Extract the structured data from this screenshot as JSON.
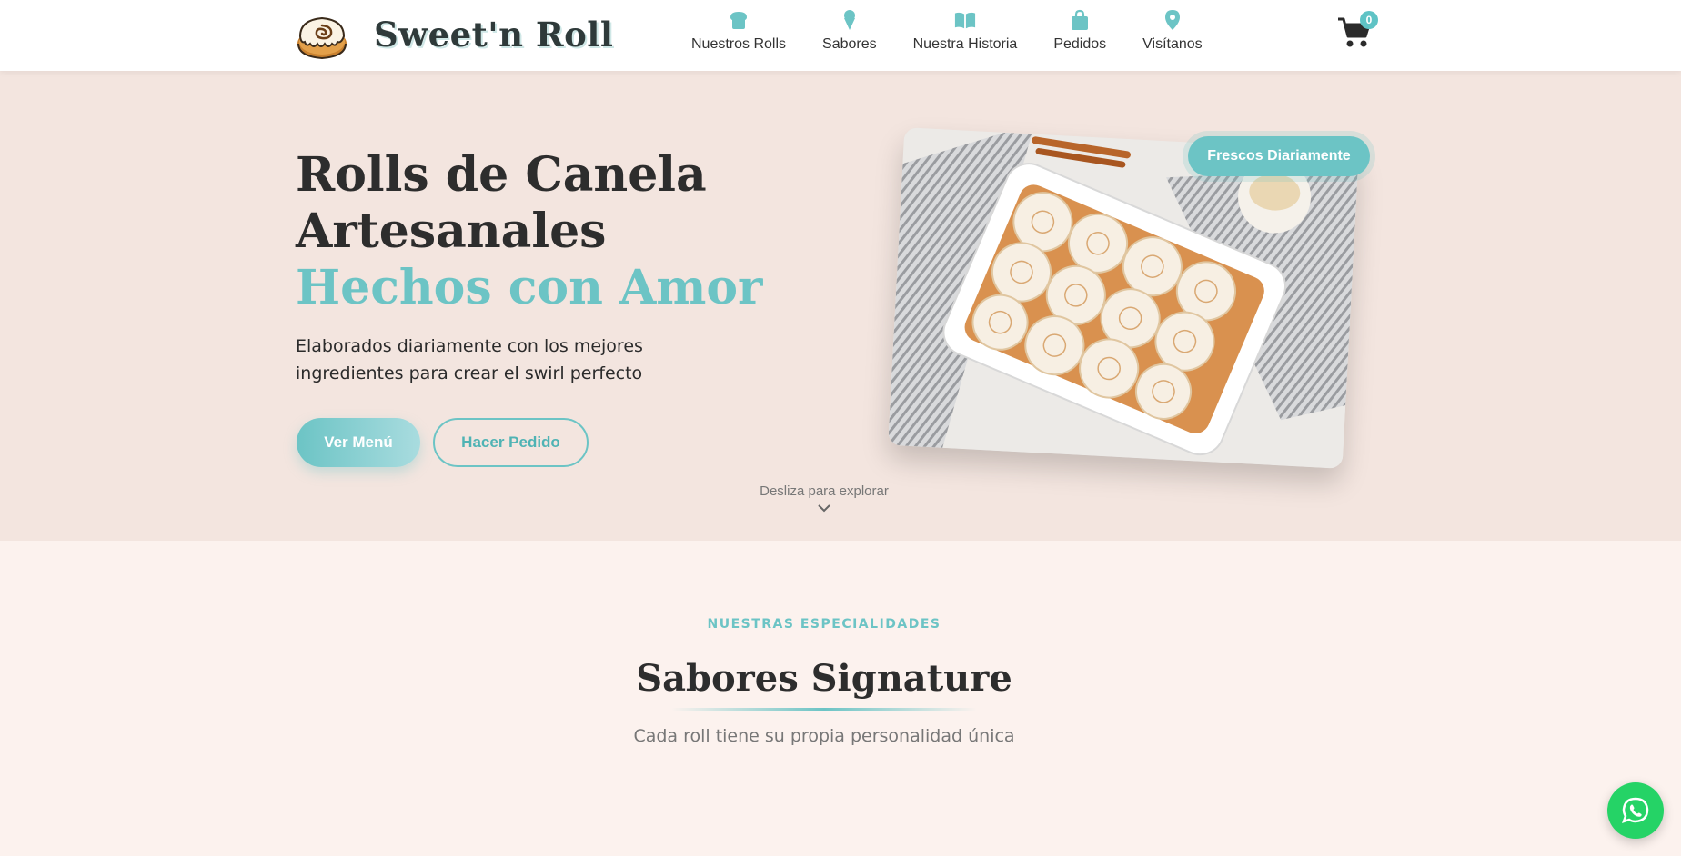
{
  "header": {
    "brand_name": "Sweet'n Roll",
    "logo_icon": "cinnamon-roll-icon",
    "nav": [
      {
        "label": "Nuestros Rolls",
        "icon": "bread-icon"
      },
      {
        "label": "Sabores",
        "icon": "ice-cream-icon"
      },
      {
        "label": "Nuestra Historia",
        "icon": "book-icon"
      },
      {
        "label": "Pedidos",
        "icon": "shopping-bag-icon"
      },
      {
        "label": "Visítanos",
        "icon": "map-pin-icon"
      }
    ],
    "cart_count": "0",
    "cart_icon": "shopping-cart-icon"
  },
  "hero": {
    "title_line1": "Rolls de Canela",
    "title_line2": "Artesanales",
    "title_accent": "Hechos con Amor",
    "subtitle": "Elaborados diariamente con los mejores ingredientes para crear el swirl perfecto",
    "primary_button": "Ver Menú",
    "secondary_button": "Hacer Pedido",
    "badge": "Frescos Diariamente",
    "scroll_hint": "Desliza para explorar"
  },
  "specialties": {
    "eyebrow": "NUESTRAS ESPECIALIDADES",
    "title": "Sabores Signature",
    "subtitle": "Cada roll tiene su propia personalidad única"
  },
  "colors": {
    "accent": "#6cc4c5",
    "hero_bg": "#f3e5df",
    "section_bg": "#fcf2ee",
    "whatsapp": "#25d366"
  },
  "floating": {
    "whatsapp_icon": "whatsapp-icon"
  }
}
